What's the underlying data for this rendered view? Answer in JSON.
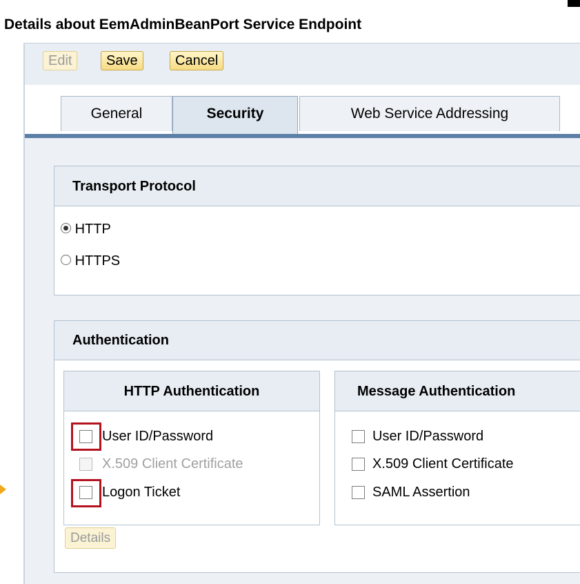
{
  "title": "Details about EemAdminBeanPort Service Endpoint",
  "toolbar": {
    "edit": "Edit",
    "save": "Save",
    "cancel": "Cancel"
  },
  "tabs": {
    "general": "General",
    "security": "Security",
    "wsa": "Web Service Addressing"
  },
  "transport": {
    "heading": "Transport Protocol",
    "options": [
      {
        "label": "HTTP",
        "selected": true
      },
      {
        "label": "HTTPS",
        "selected": false
      }
    ]
  },
  "authentication": {
    "heading": "Authentication",
    "http": {
      "heading": "HTTP Authentication",
      "items": [
        {
          "label": "User ID/Password",
          "checked": false,
          "enabled": true
        },
        {
          "label": "X.509 Client Certificate",
          "checked": false,
          "enabled": false
        },
        {
          "label": "Logon Ticket",
          "checked": false,
          "enabled": true
        }
      ]
    },
    "message": {
      "heading": "Message Authentication",
      "items": [
        {
          "label": "User ID/Password",
          "checked": false
        },
        {
          "label": "X.509 Client Certificate",
          "checked": false
        },
        {
          "label": "SAML Assertion",
          "checked": false
        }
      ]
    },
    "details_button": "Details"
  },
  "colors": {
    "accent_bar": "#5b7fa6",
    "highlight": "#b3121e",
    "arrow": "#f0a81d"
  }
}
